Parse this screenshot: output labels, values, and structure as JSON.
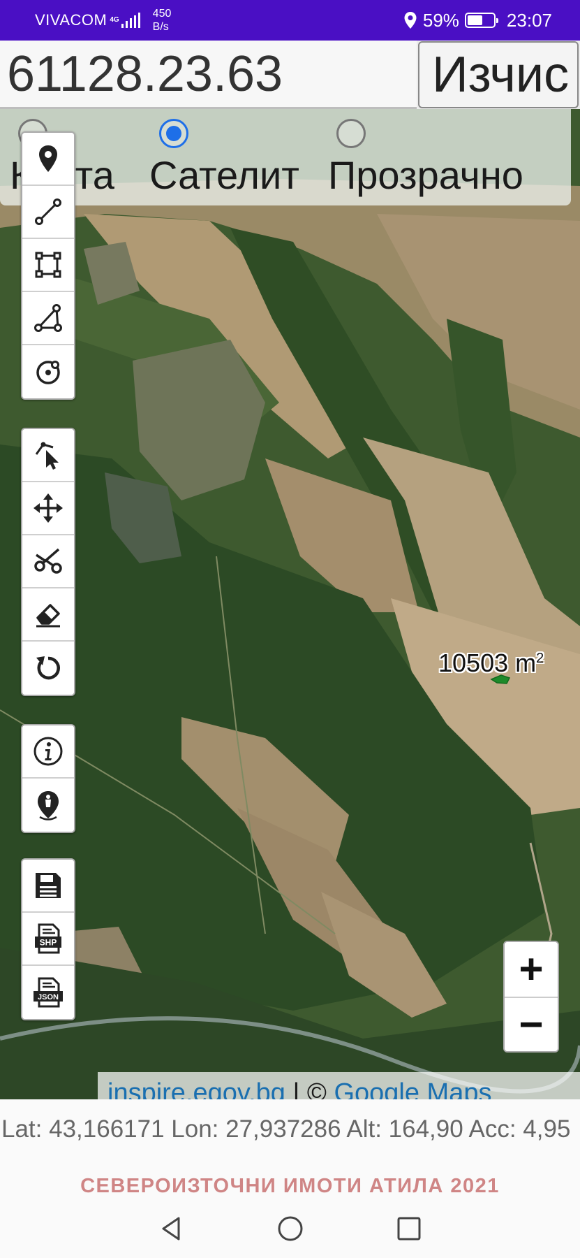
{
  "status_bar": {
    "carrier": "VIVACOM",
    "network_type": "4G",
    "speed_value": "450",
    "speed_unit": "B/s",
    "battery": "59%",
    "time": "23:07"
  },
  "top": {
    "area_value": "61128.23.63",
    "calculate_label": "Изчис"
  },
  "map_layers": [
    {
      "label": "Карта",
      "selected": false
    },
    {
      "label": "Сателит",
      "selected": true
    },
    {
      "label": "Прозрачно",
      "selected": false
    }
  ],
  "toolbar_icons": {
    "group1": [
      "marker-icon",
      "line-icon",
      "polygon-icon",
      "angle-icon",
      "circle-icon"
    ],
    "group2": [
      "select-icon",
      "move-icon",
      "cut-icon",
      "eraser-icon",
      "undo-icon"
    ],
    "group3": [
      "info-icon",
      "my-location-icon"
    ],
    "group4": [
      "save-icon",
      "shp-export-icon",
      "json-export-icon"
    ]
  },
  "export_labels": {
    "shp": "SHP",
    "json": "JSON"
  },
  "zoom": {
    "in": "+",
    "out": "−"
  },
  "measurement": {
    "value": "10503 m",
    "unit_sup": "2"
  },
  "attribution": {
    "source1": "inspire.egov.bg",
    "separator": " | © ",
    "source2": "Google Maps"
  },
  "position": {
    "text": "Lat: 43,166171 Lon: 27,937286 Alt: 164,90 Acc: 4,95"
  },
  "footer": {
    "brand": "СЕВЕРОИЗТОЧНИ ИМОТИ АТИЛА 2021"
  },
  "colors": {
    "status_bar": "#4a0fc4",
    "radio_active": "#1e6fe8",
    "brand": "#cf8585",
    "link": "#1a6fb0"
  }
}
